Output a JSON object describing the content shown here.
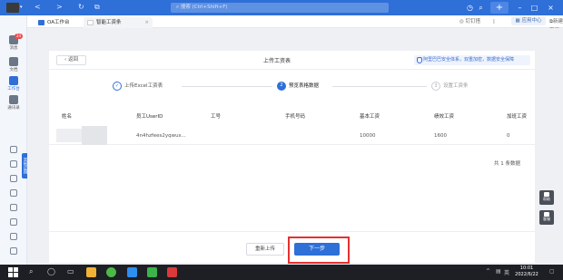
{
  "titlebar": {
    "search_placeholder": "搜索 (Ctrl+Shift+F)",
    "nav_back": "<",
    "nav_forward": ">",
    "nav_refresh": "↻",
    "nav_tab": "⧉",
    "plus_label": "+"
  },
  "sidebar": {
    "items": [
      {
        "label": "消息",
        "badge": "24"
      },
      {
        "label": "文档"
      },
      {
        "label": "工作台"
      },
      {
        "label": "通讯录"
      }
    ],
    "vertical_label": "其他应用"
  },
  "tabs": [
    {
      "label": "OA工作台"
    },
    {
      "label": "智能工资条",
      "close": "×"
    }
  ],
  "topstrip": {
    "dingding": "钉钉搭",
    "app_center": "应用中心",
    "new_window": "新建窗口"
  },
  "card": {
    "back_label": "返回",
    "title": "上传工资表",
    "secure_text": "阿里巴巴安全体系，双重加密，数据安全保障"
  },
  "steps": [
    {
      "num": "✓",
      "label": "上传Excel工资表",
      "state": "done"
    },
    {
      "num": "2",
      "label": "预览表格数据",
      "state": "current"
    },
    {
      "num": "3",
      "label": "设置工资条",
      "state": "todo"
    }
  ],
  "table": {
    "headers": [
      "姓名",
      "员工UserID",
      "工号",
      "手机号码",
      "基本工资",
      "绩效工资",
      "加班工资"
    ],
    "rows": [
      [
        "",
        "4n4hzfees2yqwus...",
        "",
        "",
        "10000",
        "1600",
        "0"
      ]
    ],
    "total_text": "共 1 条数据"
  },
  "footer": {
    "reupload_label": "重新上传",
    "next_label": "下一步"
  },
  "right_helpers": [
    {
      "label": "帮助"
    },
    {
      "label": "客服"
    }
  ],
  "taskbar": {
    "time": "10:01",
    "date": "2022/6/22",
    "lang": "英"
  },
  "colors": {
    "brand": "#2e6fd8",
    "highlight": "#e53030",
    "badge": "#f04a4a"
  }
}
